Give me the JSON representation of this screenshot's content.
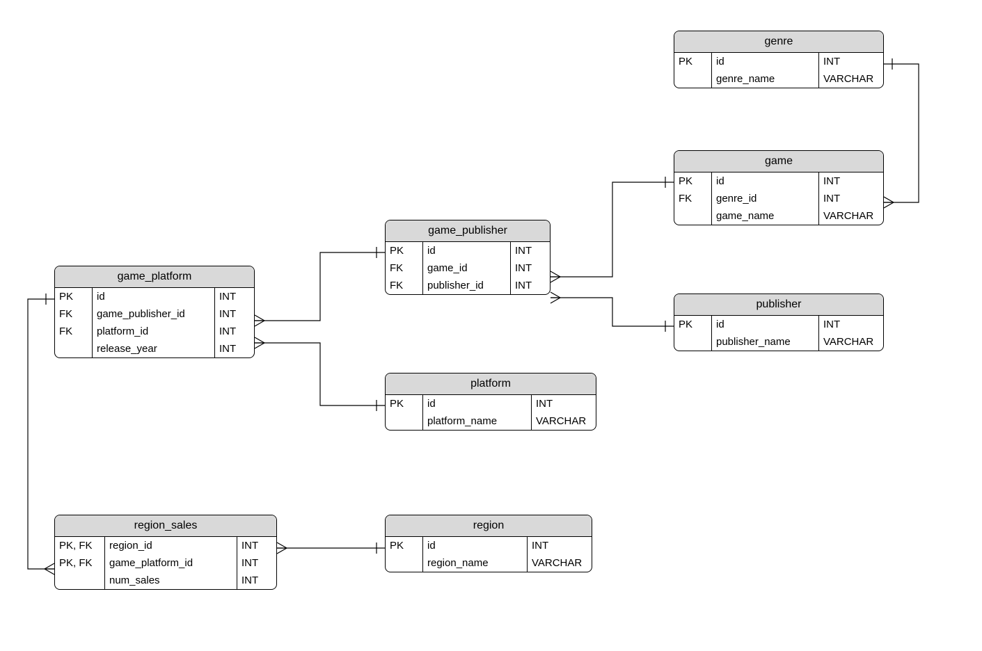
{
  "entities": {
    "genre": {
      "title": "genre",
      "rows": [
        {
          "key": "PK",
          "name": "id",
          "type": "INT"
        },
        {
          "key": "",
          "name": "genre_name",
          "type": "VARCHAR"
        }
      ]
    },
    "game": {
      "title": "game",
      "rows": [
        {
          "key": "PK",
          "name": "id",
          "type": "INT"
        },
        {
          "key": "FK",
          "name": "genre_id",
          "type": "INT"
        },
        {
          "key": "",
          "name": "game_name",
          "type": "VARCHAR"
        }
      ]
    },
    "publisher": {
      "title": "publisher",
      "rows": [
        {
          "key": "PK",
          "name": "id",
          "type": "INT"
        },
        {
          "key": "",
          "name": "publisher_name",
          "type": "VARCHAR"
        }
      ]
    },
    "game_publisher": {
      "title": "game_publisher",
      "rows": [
        {
          "key": "PK",
          "name": "id",
          "type": "INT"
        },
        {
          "key": "FK",
          "name": "game_id",
          "type": "INT"
        },
        {
          "key": "FK",
          "name": "publisher_id",
          "type": "INT"
        }
      ]
    },
    "platform": {
      "title": "platform",
      "rows": [
        {
          "key": "PK",
          "name": "id",
          "type": "INT"
        },
        {
          "key": "",
          "name": "platform_name",
          "type": "VARCHAR"
        }
      ]
    },
    "game_platform": {
      "title": "game_platform",
      "rows": [
        {
          "key": "PK",
          "name": "id",
          "type": "INT"
        },
        {
          "key": "FK",
          "name": "game_publisher_id",
          "type": "INT"
        },
        {
          "key": "FK",
          "name": "platform_id",
          "type": "INT"
        },
        {
          "key": "",
          "name": "release_year",
          "type": "INT"
        }
      ]
    },
    "region": {
      "title": "region",
      "rows": [
        {
          "key": "PK",
          "name": "id",
          "type": "INT"
        },
        {
          "key": "",
          "name": "region_name",
          "type": "VARCHAR"
        }
      ]
    },
    "region_sales": {
      "title": "region_sales",
      "rows": [
        {
          "key": "PK, FK",
          "name": "region_id",
          "type": "INT"
        },
        {
          "key": "PK, FK",
          "name": "game_platform_id",
          "type": "INT"
        },
        {
          "key": "",
          "name": "num_sales",
          "type": "INT"
        }
      ]
    }
  },
  "relationships": [
    {
      "from": "game.genre_id",
      "to": "genre.id",
      "type": "many-to-one"
    },
    {
      "from": "game_publisher.game_id",
      "to": "game.id",
      "type": "many-to-one"
    },
    {
      "from": "game_publisher.publisher_id",
      "to": "publisher.id",
      "type": "many-to-one"
    },
    {
      "from": "game_platform.game_publisher_id",
      "to": "game_publisher.id",
      "type": "many-to-one"
    },
    {
      "from": "game_platform.platform_id",
      "to": "platform.id",
      "type": "many-to-one"
    },
    {
      "from": "region_sales.region_id",
      "to": "region.id",
      "type": "many-to-one"
    },
    {
      "from": "region_sales.game_platform_id",
      "to": "game_platform.id",
      "type": "many-to-one"
    }
  ]
}
